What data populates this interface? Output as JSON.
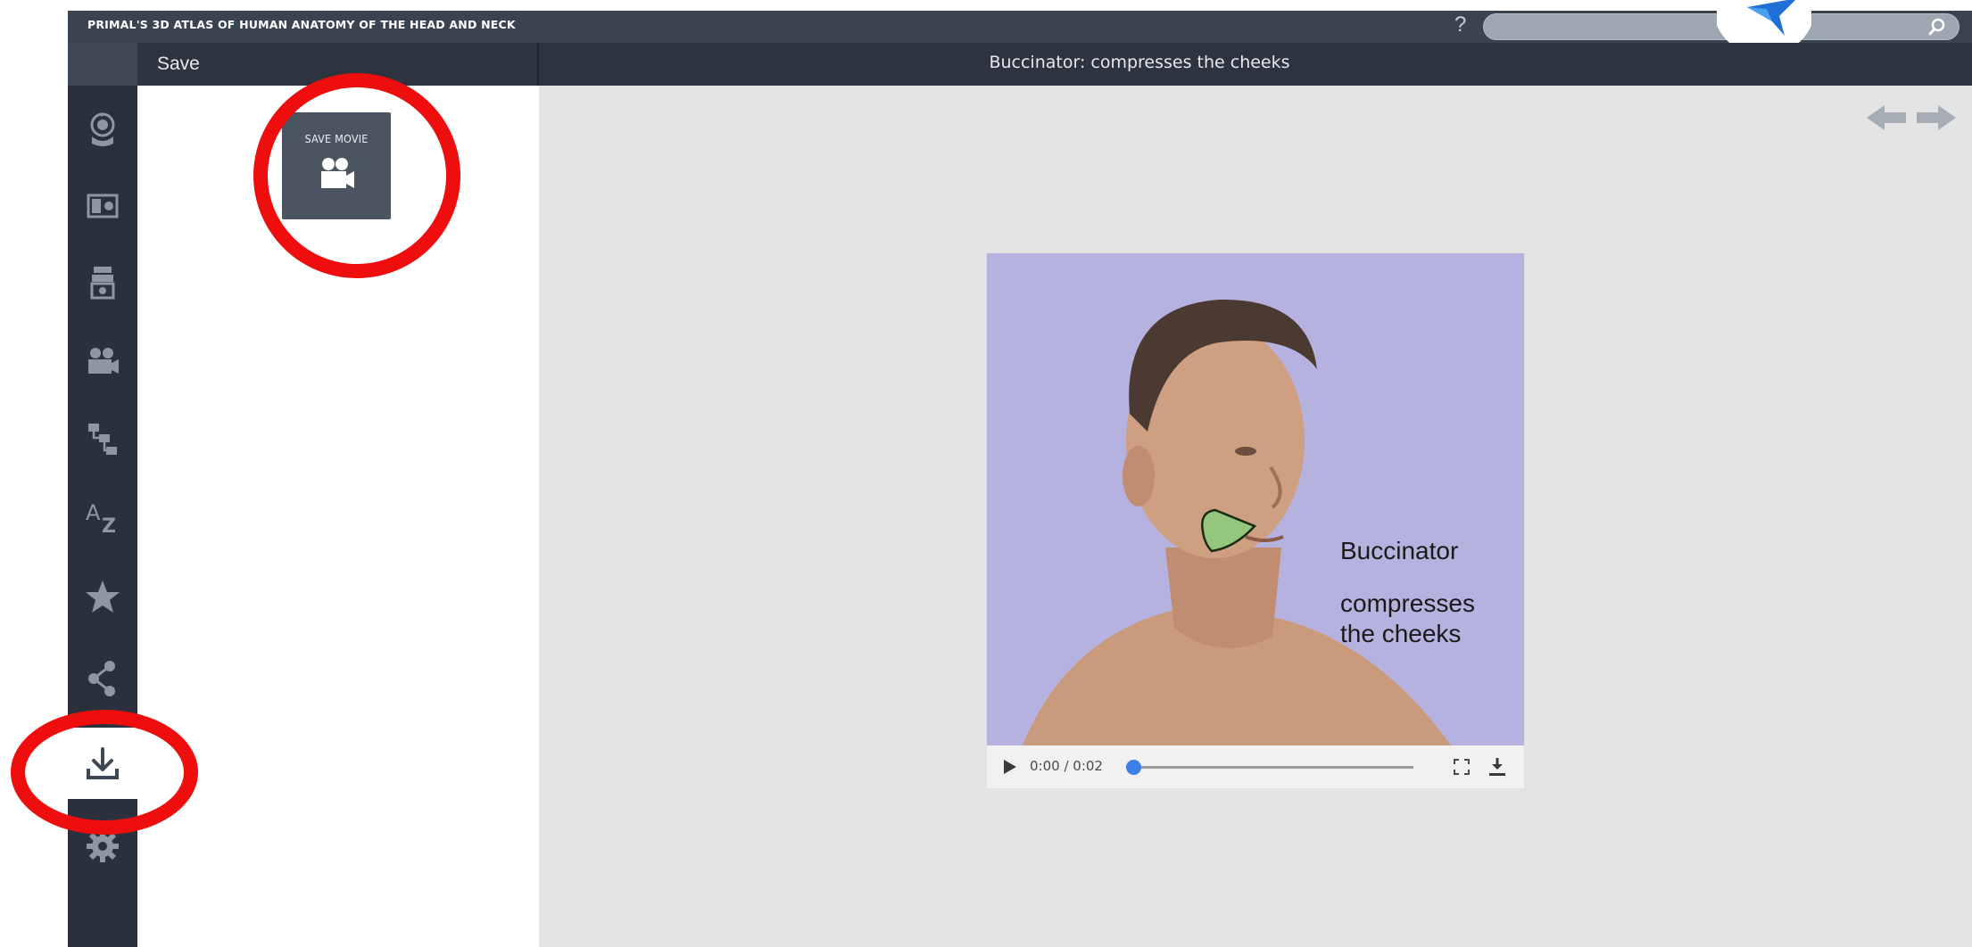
{
  "app": {
    "title": "PRIMAL'S 3D ATLAS OF HUMAN ANATOMY OF THE HEAD AND NECK",
    "help_label": "?"
  },
  "toolbar": {
    "save_label": "Save",
    "page_title": "Buccinator: compresses the cheeks"
  },
  "sidebar": {
    "items": [
      {
        "name": "3d-model",
        "icon": "rotate-head-icon"
      },
      {
        "name": "slides",
        "icon": "slides-icon"
      },
      {
        "name": "dissections",
        "icon": "layers-icon"
      },
      {
        "name": "movies",
        "icon": "movie-camera-icon"
      },
      {
        "name": "hierarchy",
        "icon": "tree-icon"
      },
      {
        "name": "index",
        "icon": "az-icon"
      },
      {
        "name": "favorites",
        "icon": "star-icon"
      },
      {
        "name": "share",
        "icon": "share-icon"
      },
      {
        "name": "save",
        "icon": "download-icon",
        "active": true
      },
      {
        "name": "settings",
        "icon": "gear-icon"
      }
    ]
  },
  "panel": {
    "save_movie_label": "SAVE MOVIE"
  },
  "video": {
    "caption_title": "Buccinator",
    "caption_sub": "compresses the cheeks",
    "time": "0:00 / 0:02",
    "progress": 0.0
  },
  "colors": {
    "topbar": "#3a4350",
    "subbar": "#2d3440",
    "sidebar": "#2b313c",
    "viewer_bg": "#e4e4e4",
    "annotation": "#ee0e0e",
    "video_bg": "#b8b4e0",
    "progress_knob": "#3b80e6"
  }
}
